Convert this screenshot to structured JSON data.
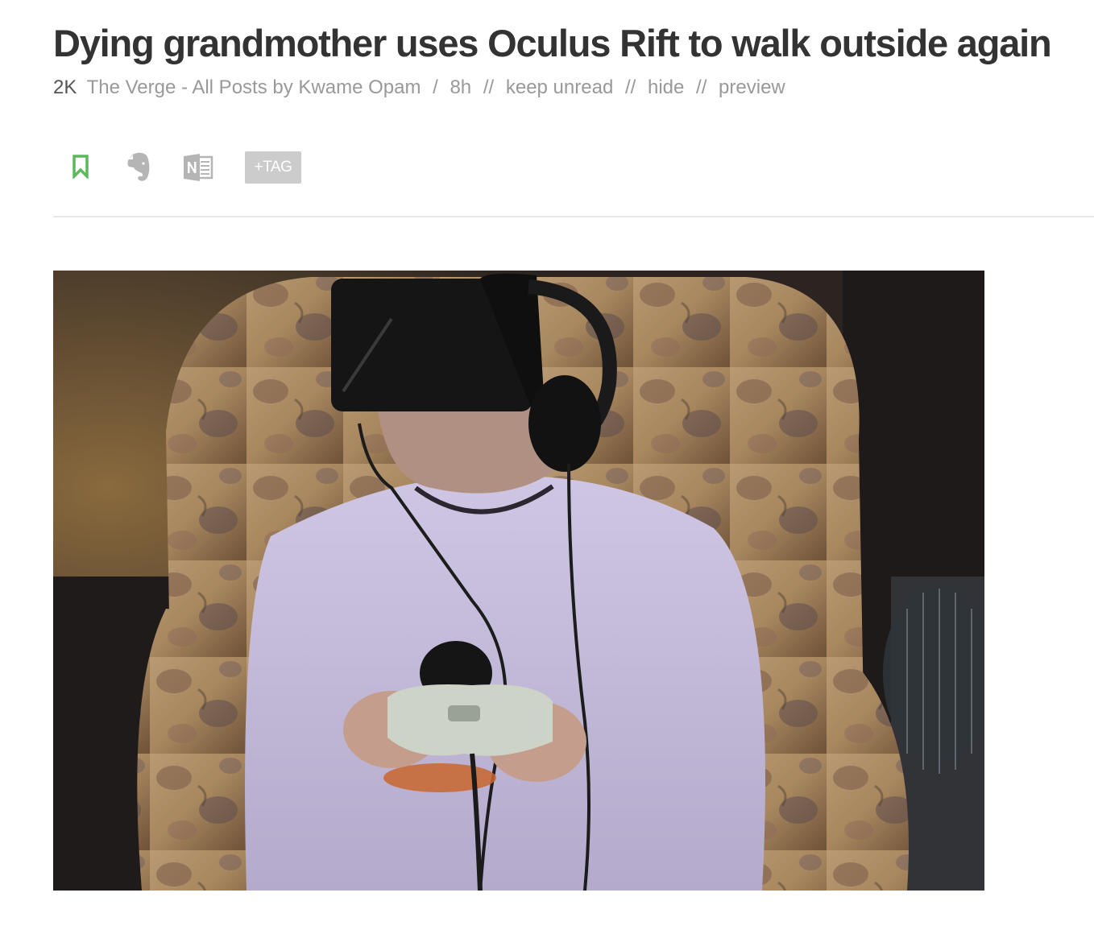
{
  "article": {
    "title": "Dying grandmother uses Oculus Rift to walk outside again",
    "meta": {
      "count": "2K",
      "source": "The Verge - All Posts by Kwame Opam",
      "age": "8h",
      "keep_unread": "keep unread",
      "hide": "hide",
      "preview": "preview",
      "sep_slash": "/",
      "sep_double": "//"
    },
    "actions": {
      "tag_label": "+TAG",
      "bookmark_icon": "bookmark-icon",
      "evernote_icon": "evernote-icon",
      "onenote_icon": "onenote-icon"
    },
    "image": {
      "alt": "Elderly woman in a lavender sweatshirt sitting in a floral armchair wearing an Oculus Rift headset and headphones, holding a game controller"
    }
  },
  "colors": {
    "title": "#333333",
    "meta": "#999999",
    "bookmark_green": "#5cb85c",
    "icon_gray": "#b5b5b5",
    "tag_bg": "#cccccc"
  }
}
